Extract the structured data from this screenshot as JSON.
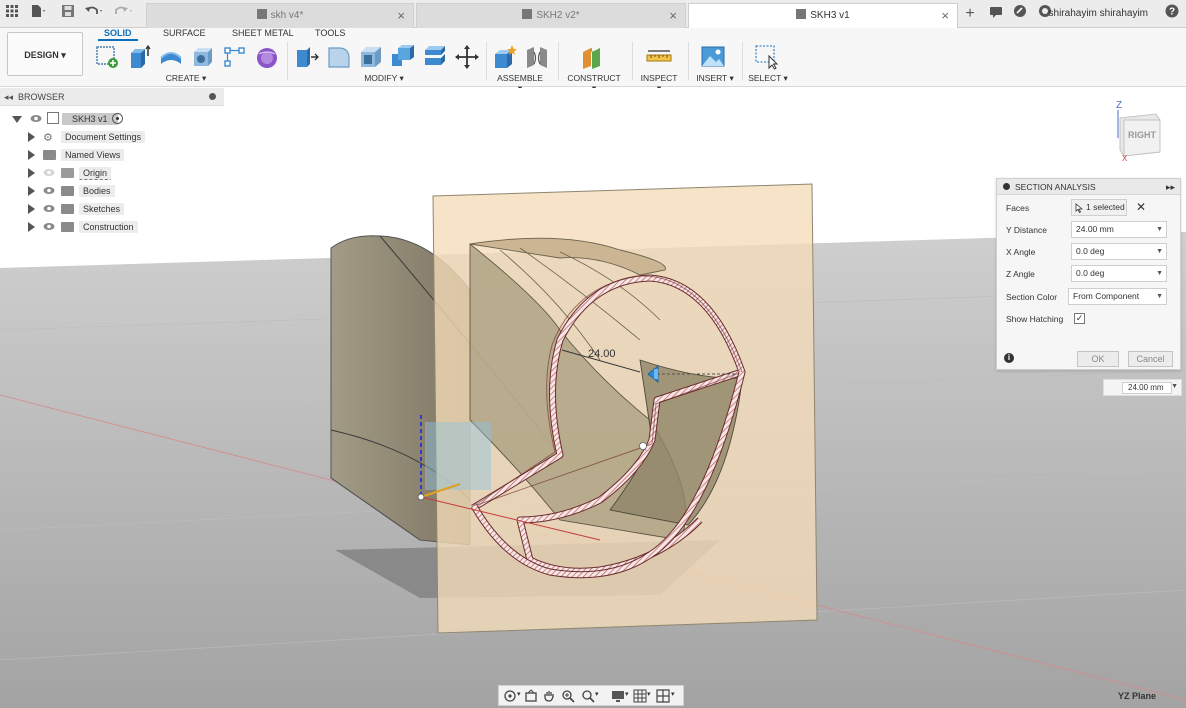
{
  "tabs": [
    {
      "label": "skh v4*"
    },
    {
      "label": "SKH2 v2*"
    },
    {
      "label": "SKH3 v1"
    }
  ],
  "user": {
    "name": "shirahayim shirahayim"
  },
  "workspace": {
    "label": "DESIGN"
  },
  "toolbar_tabs": [
    {
      "label": "SOLID"
    },
    {
      "label": "SURFACE"
    },
    {
      "label": "SHEET METAL"
    },
    {
      "label": "TOOLS"
    }
  ],
  "toolbar_groups": [
    {
      "label": "CREATE"
    },
    {
      "label": "MODIFY"
    },
    {
      "label": "ASSEMBLE"
    },
    {
      "label": "CONSTRUCT"
    },
    {
      "label": "INSPECT"
    },
    {
      "label": "INSERT"
    },
    {
      "label": "SELECT"
    }
  ],
  "browser": {
    "title": "BROWSER",
    "root": "SKH3 v1",
    "items": [
      {
        "label": "Document Settings"
      },
      {
        "label": "Named Views"
      },
      {
        "label": "Origin"
      },
      {
        "label": "Bodies"
      },
      {
        "label": "Sketches"
      },
      {
        "label": "Construction"
      }
    ]
  },
  "viewcube": {
    "face": "RIGHT",
    "axis_z": "Z",
    "axis_x": "X"
  },
  "viewport": {
    "dimension_label": "24.00"
  },
  "section_analysis": {
    "title": "SECTION ANALYSIS",
    "rows": {
      "faces": {
        "label": "Faces",
        "value": "1 selected"
      },
      "y_distance": {
        "label": "Y Distance",
        "value": "24.00 mm"
      },
      "x_angle": {
        "label": "X Angle",
        "value": "0.0 deg"
      },
      "z_angle": {
        "label": "Z Angle",
        "value": "0.0 deg"
      },
      "section_color": {
        "label": "Section Color",
        "value": "From Component"
      },
      "show_hatching": {
        "label": "Show Hatching",
        "checked": true
      }
    },
    "ok_label": "OK",
    "cancel_label": "Cancel"
  },
  "distance_input": {
    "value": "24.00 mm"
  },
  "view_name": "YZ Plane",
  "colors": {
    "accent": "#0a6fbd",
    "section_plane": "#f5dcb8",
    "model": "#9c9178"
  }
}
